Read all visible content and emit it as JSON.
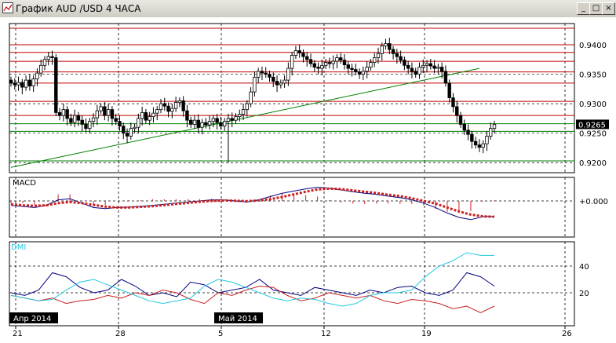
{
  "window": {
    "title": "График AUD /USD  4 ЧАСА",
    "buttons": [
      "_",
      "□",
      "×"
    ]
  },
  "price_panel": {
    "y_ticks": [
      "0.9400",
      "0.9350",
      "0.9300",
      "0.9250",
      "0.9200"
    ],
    "current_price": "0.9265"
  },
  "macd_panel": {
    "label": "MACD",
    "y_tick": "+0.000"
  },
  "dmi_panel": {
    "label": "DMI",
    "y_ticks": [
      "40",
      "20"
    ]
  },
  "x_axis": {
    "ticks": [
      "21",
      "28",
      "5",
      "12",
      "19",
      "26"
    ],
    "month_labels": [
      "Апр 2014",
      "Май 2014"
    ]
  },
  "colors": {
    "resistance": "#c00000",
    "support": "#008000",
    "candle": "#000000",
    "macd_signal": "#cc2020",
    "macd_line": "#000080",
    "dmi_plus": "#000080",
    "dmi_minus": "#cc2020",
    "adx": "#22c8e0"
  },
  "chart_data": [
    {
      "type": "candlestick",
      "title": "График AUD /USD  4 ЧАСА",
      "y_ticks": [
        0.94,
        0.935,
        0.93,
        0.925,
        0.92
      ],
      "ylim": [
        0.9183,
        0.9436
      ],
      "current_price": 0.9265,
      "resistance_levels": [
        0.9428,
        0.94,
        0.9387,
        0.9372,
        0.9354,
        0.9335,
        0.9304,
        0.928
      ],
      "support_levels": [
        0.9266,
        0.9253,
        0.9203
      ],
      "trend_line": [
        [
          0,
          0.9192
        ],
        [
          125,
          0.936
        ]
      ],
      "close": [
        0.9335,
        0.9332,
        0.9336,
        0.9328,
        0.934,
        0.933,
        0.9342,
        0.9352,
        0.9365,
        0.9375,
        0.938,
        0.9378,
        0.9285,
        0.928,
        0.929,
        0.9275,
        0.9268,
        0.928,
        0.9272,
        0.9265,
        0.9258,
        0.927,
        0.9276,
        0.9288,
        0.9295,
        0.928,
        0.929,
        0.9275,
        0.927,
        0.9262,
        0.925,
        0.9245,
        0.9258,
        0.926,
        0.9275,
        0.9285,
        0.9272,
        0.9278,
        0.9284,
        0.929,
        0.93,
        0.9296,
        0.9287,
        0.9292,
        0.9302,
        0.9305,
        0.9288,
        0.9272,
        0.9265,
        0.9272,
        0.926,
        0.9268,
        0.9264,
        0.927,
        0.9275,
        0.9268,
        0.9262,
        0.927,
        0.9275,
        0.9272,
        0.9278,
        0.9282,
        0.929,
        0.93,
        0.932,
        0.9345,
        0.9355,
        0.9352,
        0.935,
        0.9345,
        0.9338,
        0.9332,
        0.9335,
        0.934,
        0.936,
        0.9382,
        0.939,
        0.9386,
        0.938,
        0.9375,
        0.9368,
        0.9362,
        0.936,
        0.9365,
        0.937,
        0.9368,
        0.9372,
        0.9378,
        0.9374,
        0.9366,
        0.936,
        0.9358,
        0.9354,
        0.935,
        0.9355,
        0.9362,
        0.937,
        0.9378,
        0.9385,
        0.9398,
        0.9402,
        0.9392,
        0.9385,
        0.938,
        0.9374,
        0.9365,
        0.936,
        0.9355,
        0.935,
        0.9362,
        0.9365,
        0.9368,
        0.9364,
        0.936,
        0.9362,
        0.9355,
        0.9335,
        0.931,
        0.9295,
        0.928,
        0.9265,
        0.9255,
        0.9248,
        0.9236,
        0.923,
        0.9226,
        0.9232,
        0.9245,
        0.9258,
        0.9265
      ]
    },
    {
      "type": "line",
      "title": "MACD",
      "zero_label": "+0.000",
      "series": [
        {
          "name": "MACD",
          "values": [
            -0.2,
            -0.25,
            -0.3,
            -0.2,
            0.05,
            0.1,
            -0.1,
            -0.3,
            -0.35,
            -0.3,
            -0.28,
            -0.25,
            -0.2,
            -0.15,
            -0.1,
            -0.05,
            0,
            0.05,
            0.05,
            0,
            -0.05,
            0.05,
            0.2,
            0.35,
            0.45,
            0.55,
            0.62,
            0.58,
            0.5,
            0.42,
            0.35,
            0.3,
            0.22,
            0.15,
            0.05,
            -0.1,
            -0.3,
            -0.55,
            -0.75,
            -0.85,
            -0.72,
            -0.7
          ]
        },
        {
          "name": "Signal",
          "values": [
            -0.15,
            -0.2,
            -0.22,
            -0.2,
            -0.1,
            -0.05,
            -0.1,
            -0.18,
            -0.26,
            -0.3,
            -0.3,
            -0.27,
            -0.24,
            -0.19,
            -0.14,
            -0.09,
            -0.04,
            0,
            0.02,
            0.01,
            -0.01,
            0.02,
            0.08,
            0.18,
            0.3,
            0.42,
            0.52,
            0.56,
            0.54,
            0.48,
            0.42,
            0.36,
            0.28,
            0.22,
            0.12,
            0,
            -0.12,
            -0.3,
            -0.48,
            -0.62,
            -0.7,
            -0.72
          ]
        }
      ]
    },
    {
      "type": "line",
      "title": "DMI",
      "y_ticks": [
        40,
        20
      ],
      "series": [
        {
          "name": "+DI",
          "values": [
            20,
            18,
            22,
            35,
            32,
            24,
            20,
            22,
            30,
            25,
            18,
            20,
            17,
            28,
            26,
            20,
            22,
            24,
            30,
            22,
            20,
            18,
            24,
            22,
            20,
            18,
            22,
            20,
            24,
            25,
            20,
            18,
            22,
            35,
            32,
            25
          ]
        },
        {
          "name": "-DI",
          "values": [
            18,
            16,
            14,
            16,
            12,
            14,
            15,
            18,
            16,
            20,
            18,
            22,
            20,
            15,
            12,
            20,
            18,
            22,
            25,
            24,
            18,
            14,
            16,
            20,
            18,
            16,
            18,
            14,
            12,
            15,
            14,
            12,
            8,
            10,
            5,
            10
          ]
        },
        {
          "name": "ADX",
          "values": [
            18,
            16,
            14,
            15,
            22,
            28,
            30,
            26,
            22,
            18,
            14,
            12,
            14,
            16,
            25,
            30,
            28,
            24,
            20,
            16,
            14,
            16,
            15,
            12,
            10,
            12,
            18,
            20,
            20,
            22,
            32,
            40,
            44,
            50,
            48,
            48
          ]
        }
      ]
    }
  ]
}
